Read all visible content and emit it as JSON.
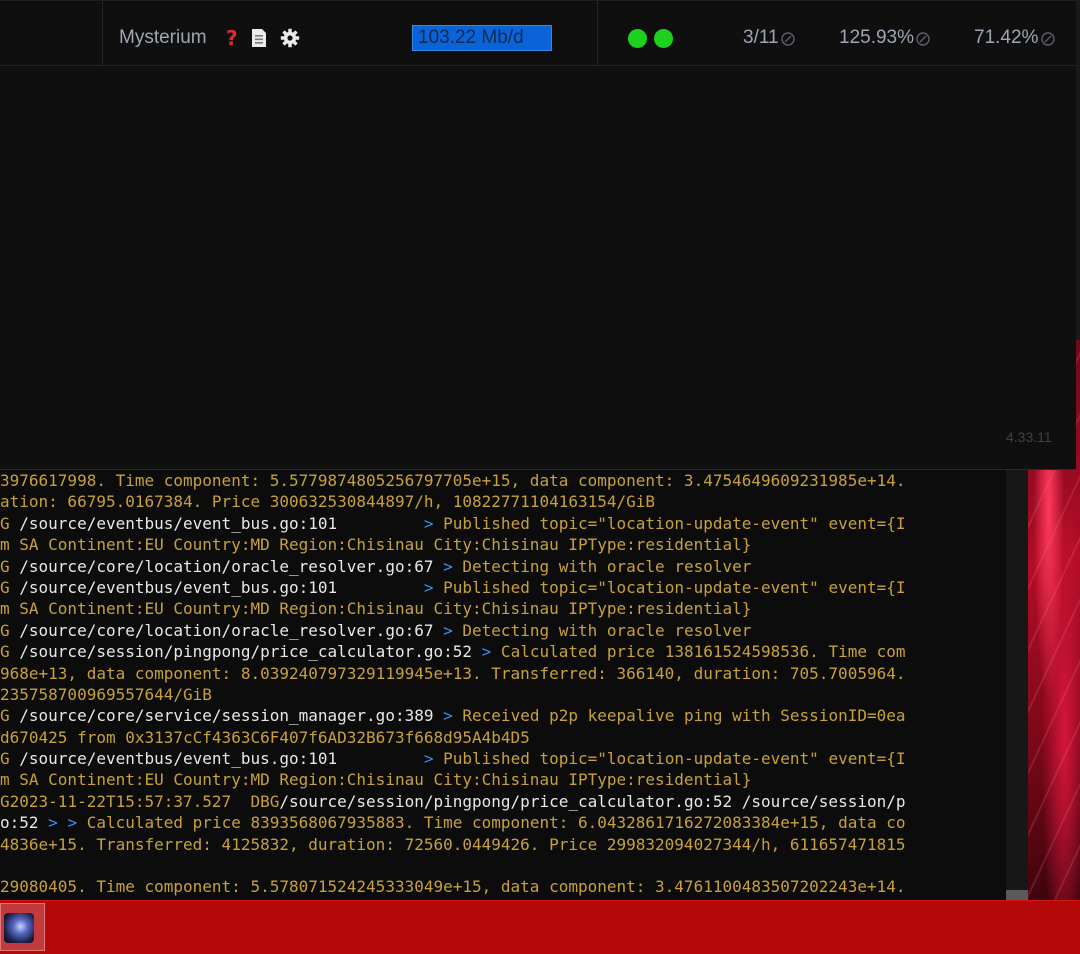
{
  "colors": {
    "accent_blue": "#0a64d8",
    "status_green": "#1fd11f",
    "log_text": "#c8a13a",
    "log_path": "#e8e8e8",
    "log_arrow": "#3b8eea",
    "taskbar": "#b50808"
  },
  "dashboard": {
    "node": {
      "name": "Mysterium",
      "help_icon": "question-icon",
      "doc_icon": "document-icon",
      "settings_icon": "gear-icon",
      "bandwidth": "103.22 Mb/d",
      "status": [
        "online",
        "online"
      ],
      "sessions": "3/11",
      "quality": "125.93%",
      "uptime": "71.42%"
    },
    "version": "4.33.11"
  },
  "terminal": {
    "lines": [
      [
        {
          "t": "3976617998. Time component: 5.5779874805256797705e+15, data component: 3.4754649609231985e+14.",
          "c": ""
        }
      ],
      [
        {
          "t": "ation: 66795.0167384. Price 300632530844897/h, 1082277110416315​4/GiB",
          "c": ""
        }
      ],
      [
        {
          "t": "G ",
          "c": ""
        },
        {
          "t": "/source/eventbus/event_bus.go:101",
          "c": "w"
        },
        {
          "t": "         ",
          "c": ""
        },
        {
          "t": ">",
          "c": "b"
        },
        {
          "t": " Published topic=\"location-update-event\" event={I",
          "c": ""
        }
      ],
      [
        {
          "t": "m SA Continent:EU Country:MD Region:Chisinau City:Chisinau IPType:residential}",
          "c": ""
        }
      ],
      [
        {
          "t": "G ",
          "c": ""
        },
        {
          "t": "/source/core/location/oracle_resolver.go:67",
          "c": "w"
        },
        {
          "t": " ",
          "c": ""
        },
        {
          "t": ">",
          "c": "b"
        },
        {
          "t": " Detecting with oracle resolver",
          "c": ""
        }
      ],
      [
        {
          "t": "G ",
          "c": ""
        },
        {
          "t": "/source/eventbus/event_bus.go:101",
          "c": "w"
        },
        {
          "t": "         ",
          "c": ""
        },
        {
          "t": ">",
          "c": "b"
        },
        {
          "t": " Published topic=\"location-update-event\" event={I",
          "c": ""
        }
      ],
      [
        {
          "t": "m SA Continent:EU Country:MD Region:Chisinau City:Chisinau IPType:residential}",
          "c": ""
        }
      ],
      [
        {
          "t": "G ",
          "c": ""
        },
        {
          "t": "/source/core/location/oracle_resolver.go:67",
          "c": "w"
        },
        {
          "t": " ",
          "c": ""
        },
        {
          "t": ">",
          "c": "b"
        },
        {
          "t": " Detecting with oracle resolver",
          "c": ""
        }
      ],
      [
        {
          "t": "G ",
          "c": ""
        },
        {
          "t": "/source/session/pingpong/price_calculator.go:52",
          "c": "w"
        },
        {
          "t": " ",
          "c": ""
        },
        {
          "t": ">",
          "c": "b"
        },
        {
          "t": " Calculated price 138161524598536. Time com",
          "c": ""
        }
      ],
      [
        {
          "t": "968e+13, data component: 8.039240797329119945e+13. Transferred: 366140, duration: 705.7005964.",
          "c": ""
        }
      ],
      [
        {
          "t": "235758700969557644/GiB",
          "c": ""
        }
      ],
      [
        {
          "t": "G ",
          "c": ""
        },
        {
          "t": "/source/core/service/session_manager.go:389",
          "c": "w"
        },
        {
          "t": " ",
          "c": ""
        },
        {
          "t": ">",
          "c": "b"
        },
        {
          "t": " Received p2p keepalive ping with SessionID=0ea",
          "c": ""
        }
      ],
      [
        {
          "t": "d670425 from 0x3137cCf4363C6F407f6AD32B673f668d95A4b4D5",
          "c": ""
        }
      ],
      [
        {
          "t": "G ",
          "c": ""
        },
        {
          "t": "/source/eventbus/event_bus.go:101",
          "c": "w"
        },
        {
          "t": "         ",
          "c": ""
        },
        {
          "t": ">",
          "c": "b"
        },
        {
          "t": " Published topic=\"location-update-event\" event={I",
          "c": ""
        }
      ],
      [
        {
          "t": "m SA Continent:EU Country:MD Region:Chisinau City:Chisinau IPType:residential}",
          "c": ""
        }
      ],
      [
        {
          "t": "G2023-11-22T15:57:37.527  DBG",
          "c": ""
        },
        {
          "t": "/source/session/pingpong/price_calculator.go:52 /source/session/p",
          "c": "w"
        }
      ],
      [
        {
          "t": "o:52 ",
          "c": "w"
        },
        {
          "t": "> >",
          "c": "b"
        },
        {
          "t": " Calculated price 8393568067935883. Time component: 6.0432861716272083384e+15, data co",
          "c": ""
        }
      ],
      [
        {
          "t": "4836e+15. Transferred: 4125832, duration: 72560.0449426. Price 299832094027344/h, 611657471815",
          "c": ""
        }
      ],
      [
        {
          "t": "",
          "c": ""
        }
      ],
      [
        {
          "t": "29080405. Time component: 5.578071524245333049e+15, data component: 3.476110048350720​2243e+14.",
          "c": ""
        }
      ]
    ]
  },
  "taskbar": {
    "app_icon": "terminal-app-icon"
  }
}
